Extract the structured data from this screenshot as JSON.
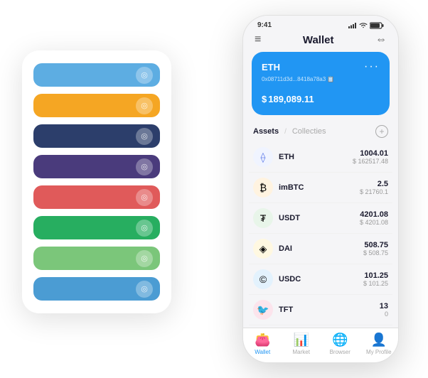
{
  "scene": {
    "back_card": {
      "rows": [
        {
          "color": "#5DADE2",
          "icon": "🔵"
        },
        {
          "color": "#F5A623",
          "icon": "🟠"
        },
        {
          "color": "#2C3E6B",
          "icon": "🔷"
        },
        {
          "color": "#4A3B7C",
          "icon": "🔮"
        },
        {
          "color": "#E05A5A",
          "icon": "🔴"
        },
        {
          "color": "#27AE60",
          "icon": "🟢"
        },
        {
          "color": "#7BC67A",
          "icon": "🟩"
        },
        {
          "color": "#4B9CD3",
          "icon": "🔵"
        }
      ]
    },
    "phone": {
      "status_bar": {
        "time": "9:41",
        "icons": "signal wifi battery"
      },
      "header": {
        "title": "Wallet",
        "left_icon": "≡",
        "right_icon": "⇔"
      },
      "eth_card": {
        "label": "ETH",
        "address": "0x08711d3d...8418a78a3",
        "address_suffix": "📋",
        "dots": "···",
        "currency_symbol": "$",
        "balance": "189,089.11"
      },
      "assets": {
        "tab_active": "Assets",
        "tab_divider": "/",
        "tab_inactive": "Collecties",
        "add_icon": "+"
      },
      "asset_list": [
        {
          "icon": "⟠",
          "icon_class": "eth-icon",
          "name": "ETH",
          "amount": "1004.01",
          "usd": "$ 162517.48"
        },
        {
          "icon": "₿",
          "icon_class": "imbtc-icon",
          "name": "imBTC",
          "amount": "2.5",
          "usd": "$ 21760.1"
        },
        {
          "icon": "₮",
          "icon_class": "usdt-icon",
          "name": "USDT",
          "amount": "4201.08",
          "usd": "$ 4201.08"
        },
        {
          "icon": "◈",
          "icon_class": "dai-icon",
          "name": "DAI",
          "amount": "508.75",
          "usd": "$ 508.75"
        },
        {
          "icon": "©",
          "icon_class": "usdc-icon",
          "name": "USDC",
          "amount": "101.25",
          "usd": "$ 101.25"
        },
        {
          "icon": "🐦",
          "icon_class": "tft-icon",
          "name": "TFT",
          "amount": "13",
          "usd": "0"
        }
      ],
      "nav": [
        {
          "icon": "👛",
          "label": "Wallet",
          "active": true
        },
        {
          "icon": "📊",
          "label": "Market",
          "active": false
        },
        {
          "icon": "🌐",
          "label": "Browser",
          "active": false
        },
        {
          "icon": "👤",
          "label": "My Profile",
          "active": false
        }
      ]
    }
  }
}
